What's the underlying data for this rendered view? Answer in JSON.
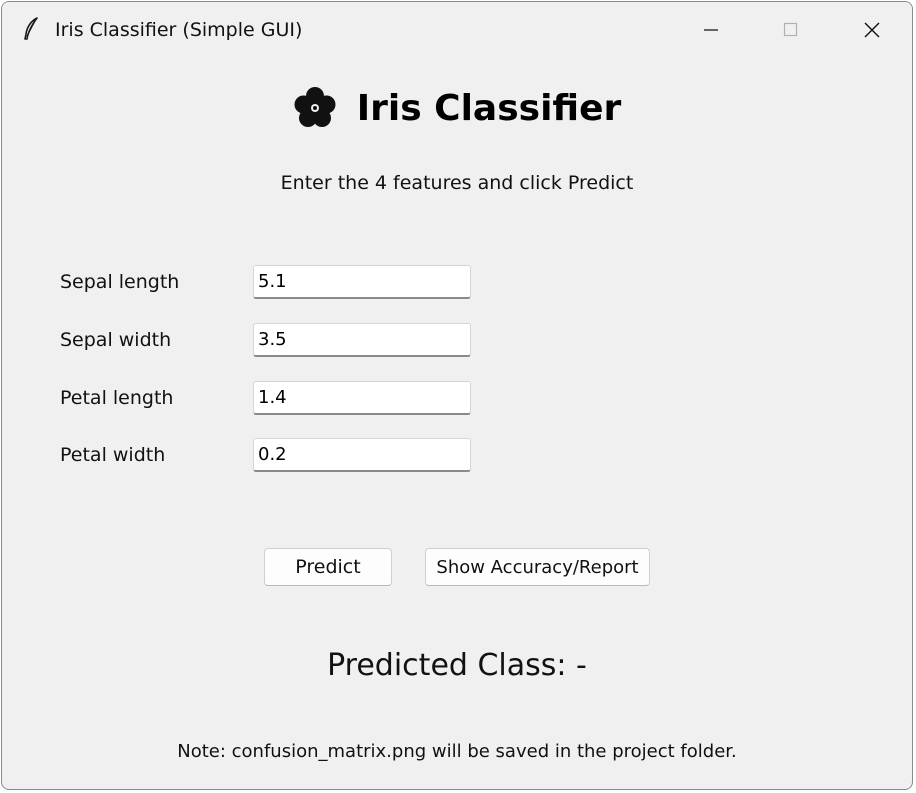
{
  "window": {
    "title": "Iris Classifier (Simple GUI)"
  },
  "header": {
    "title": "Iris Classifier",
    "icon": "flower-icon"
  },
  "instruction": "Enter the 4 features and click Predict",
  "fields": [
    {
      "label": "Sepal length",
      "value": "5.1"
    },
    {
      "label": "Sepal width",
      "value": "3.5"
    },
    {
      "label": "Petal length",
      "value": "1.4"
    },
    {
      "label": "Petal width",
      "value": "0.2"
    }
  ],
  "buttons": {
    "predict": "Predict",
    "report": "Show Accuracy/Report"
  },
  "result": "Predicted Class: -",
  "note": "Note: confusion_matrix.png will be saved in the project folder."
}
